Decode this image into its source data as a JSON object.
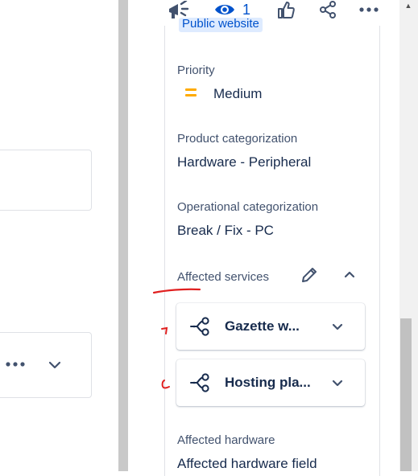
{
  "top_bar": {
    "watch_count": "1",
    "icons": [
      "megaphone-icon",
      "eye-icon",
      "thumbs-up-icon",
      "share-icon",
      "more-icon"
    ]
  },
  "tag": {
    "label": "Public website"
  },
  "fields": {
    "priority": {
      "label": "Priority",
      "value": "Medium"
    },
    "product_categorization": {
      "label": "Product categorization",
      "value": "Hardware - Peripheral"
    },
    "operational_categorization": {
      "label": "Operational categorization",
      "value": "Break / Fix - PC"
    },
    "affected_services": {
      "label": "Affected services",
      "items": [
        {
          "name": "Gazette w..."
        },
        {
          "name": "Hosting pla..."
        }
      ]
    },
    "affected_hardware": {
      "label": "Affected hardware",
      "value": "Affected hardware field"
    }
  },
  "colors": {
    "priority_medium": "#ffab00",
    "annotation_red": "#e02020",
    "link_blue": "#0052cc"
  }
}
